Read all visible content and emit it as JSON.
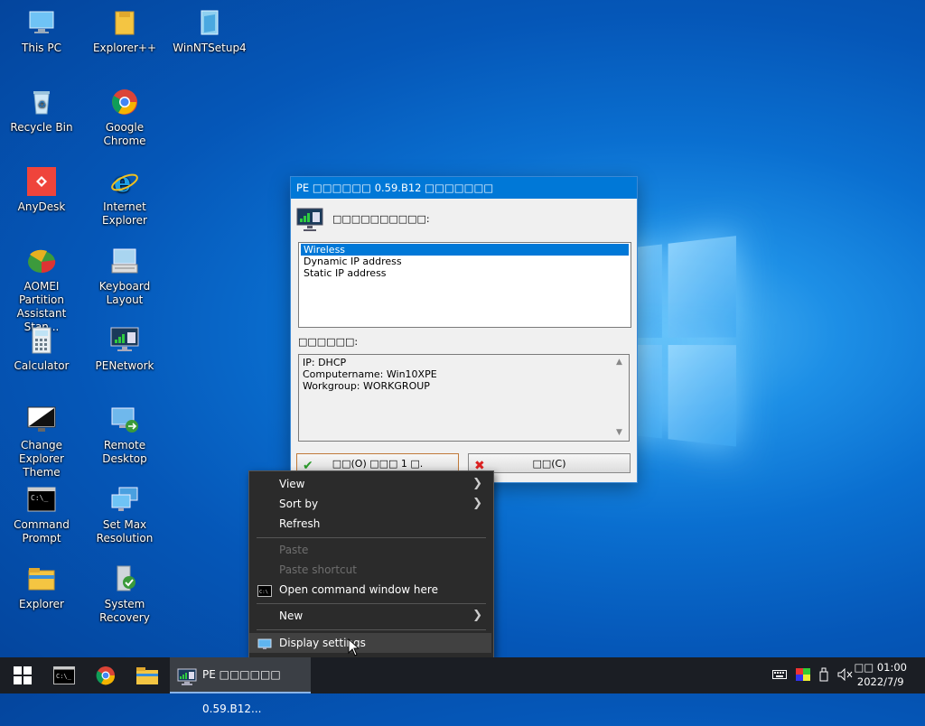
{
  "desktop": {
    "icons": [
      {
        "label": "This PC",
        "icon": "pc-icon"
      },
      {
        "label": "Explorer++",
        "icon": "folder-icon"
      },
      {
        "label": "WinNTSetup4",
        "icon": "setup-icon"
      },
      {
        "label": "Recycle Bin",
        "icon": "recycle-bin-icon"
      },
      {
        "label": "Google Chrome",
        "icon": "chrome-icon"
      },
      {
        "label": "AnyDesk",
        "icon": "anydesk-icon"
      },
      {
        "label": "Internet Explorer",
        "icon": "ie-icon"
      },
      {
        "label": "AOMEI Partition Assistant Stan...",
        "icon": "aomei-icon"
      },
      {
        "label": "Keyboard Layout",
        "icon": "keyboard-icon"
      },
      {
        "label": "Calculator",
        "icon": "calculator-icon"
      },
      {
        "label": "PENetwork",
        "icon": "network-icon"
      },
      {
        "label": "Change Explorer Theme",
        "icon": "theme-icon"
      },
      {
        "label": "Remote Desktop",
        "icon": "remote-desktop-icon"
      },
      {
        "label": "Command Prompt",
        "icon": "cmd-icon"
      },
      {
        "label": "Set Max Resolution",
        "icon": "resolution-icon"
      },
      {
        "label": "Explorer",
        "icon": "explorer-icon"
      },
      {
        "label": "System Recovery",
        "icon": "recovery-icon"
      }
    ]
  },
  "dialog": {
    "title": "PE □□□□□□ 0.59.B12 □□□□□□□",
    "heading": "□□□□□□□□□□:",
    "list_items": [
      "Wireless",
      "Dynamic IP address",
      "Static IP address"
    ],
    "selected_index": 0,
    "info_label": "□□□□□□:",
    "info_lines": [
      "IP: DHCP",
      "Computername: Win10XPE",
      "Workgroup: WORKGROUP"
    ],
    "ok_label": "□□(O) □□□ 1 □.",
    "cancel_label": "□□(C)"
  },
  "context_menu": {
    "view": "View",
    "sort_by": "Sort by",
    "refresh": "Refresh",
    "paste": "Paste",
    "paste_shortcut": "Paste shortcut",
    "open_cmd": "Open command window here",
    "new": "New",
    "display_settings": "Display settings"
  },
  "taskbar": {
    "active_app": "PE □□□□□□ 0.59.B12...",
    "time": "□□ 01:00",
    "date": "2022/7/9"
  },
  "colors": {
    "accent": "#0078d7",
    "taskbar": "#1b1e24",
    "menu_bg": "#2b2b2b"
  }
}
